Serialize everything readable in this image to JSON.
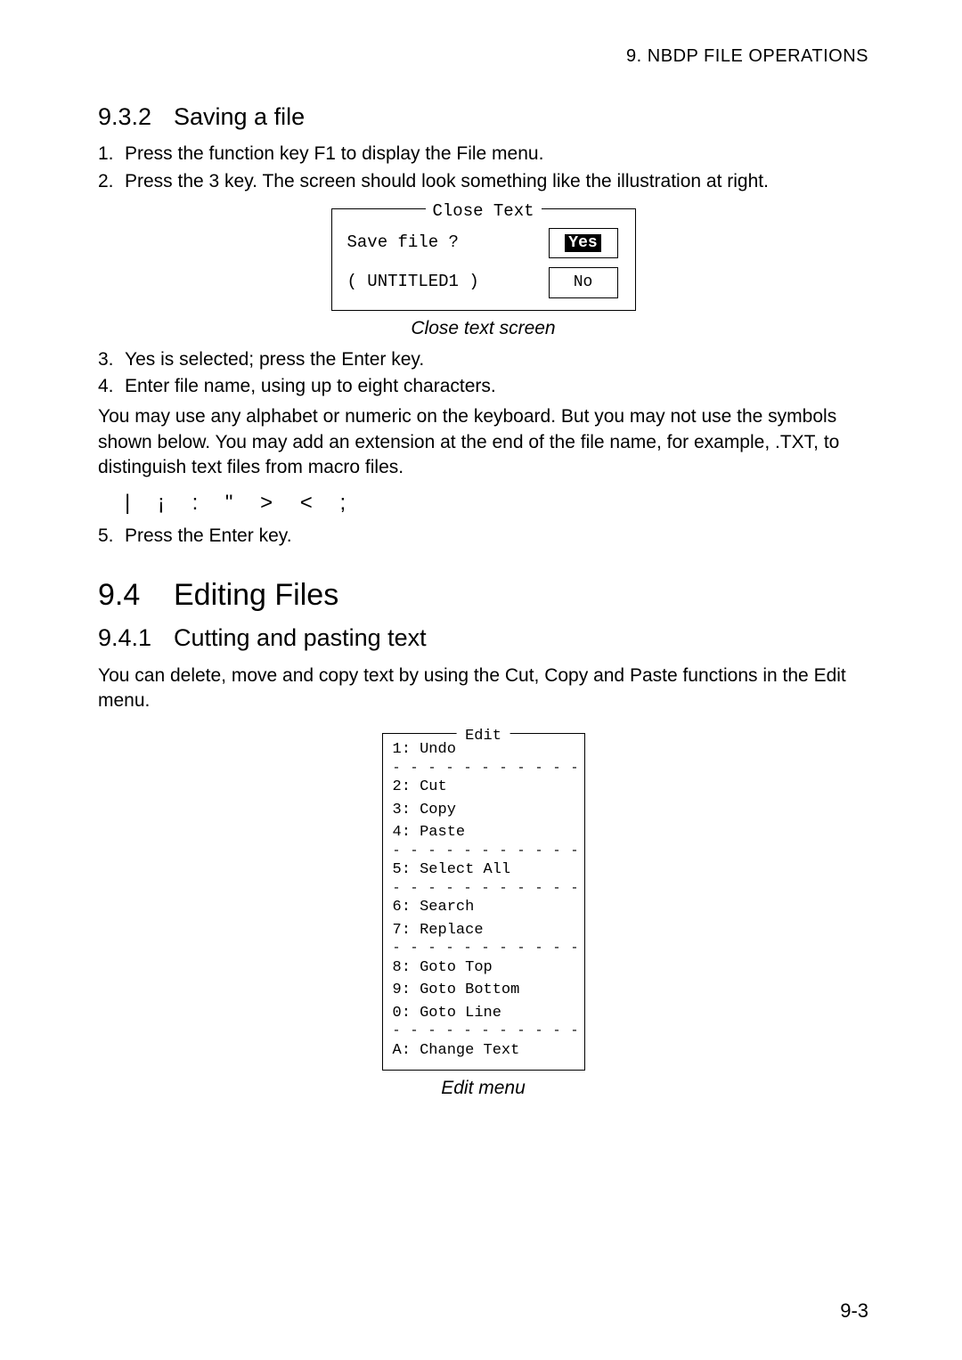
{
  "header": "9.  NBDP  FILE  OPERATIONS",
  "section932": {
    "num": "9.3.2",
    "title": "Saving a file"
  },
  "steps1": [
    {
      "n": "1.",
      "t": "Press the function key F1 to display the File menu."
    },
    {
      "n": "2.",
      "t": "Press the 3 key. The screen should look something like the illustration at right."
    }
  ],
  "closeText": {
    "title": "Close Text",
    "save": "Save file ?",
    "untitled": "( UNTITLED1   )",
    "yes": "Yes",
    "no": "No",
    "caption": "Close text screen"
  },
  "steps2": [
    {
      "n": "3.",
      "t": "Yes is selected; press the Enter key."
    },
    {
      "n": "4.",
      "t": "Enter file name, using up to eight characters."
    }
  ],
  "para1": "You may use any alphabet or numeric on the keyboard. But you may not use the symbols shown below. You may add an extension at the end of the file name, for example, .TXT, to distinguish text files from macro files.",
  "symbols": "|  ¡  :  \"  >  <   ;",
  "step5": {
    "n": "5.",
    "t": "Press the Enter key."
  },
  "section94": {
    "num": "9.4",
    "title": "Editing Files"
  },
  "section941": {
    "num": "9.4.1",
    "title": "Cutting and pasting text"
  },
  "para2": "You can delete, move and copy text by using the Cut, Copy and Paste functions in the Edit menu.",
  "editMenu": {
    "title": "Edit",
    "groups": [
      [
        "1: Undo"
      ],
      [
        "2: Cut",
        "3: Copy",
        "4: Paste"
      ],
      [
        "5: Select All"
      ],
      [
        "6: Search",
        "7: Replace"
      ],
      [
        "8: Goto Top",
        "9: Goto Bottom",
        "0: Goto Line"
      ],
      [
        "A: Change Text"
      ]
    ],
    "sep": "- - - - - - - - - - - - - - - - - - - - - - - - - - - - - - -",
    "caption": "Edit menu"
  },
  "pageNumber": "9-3"
}
